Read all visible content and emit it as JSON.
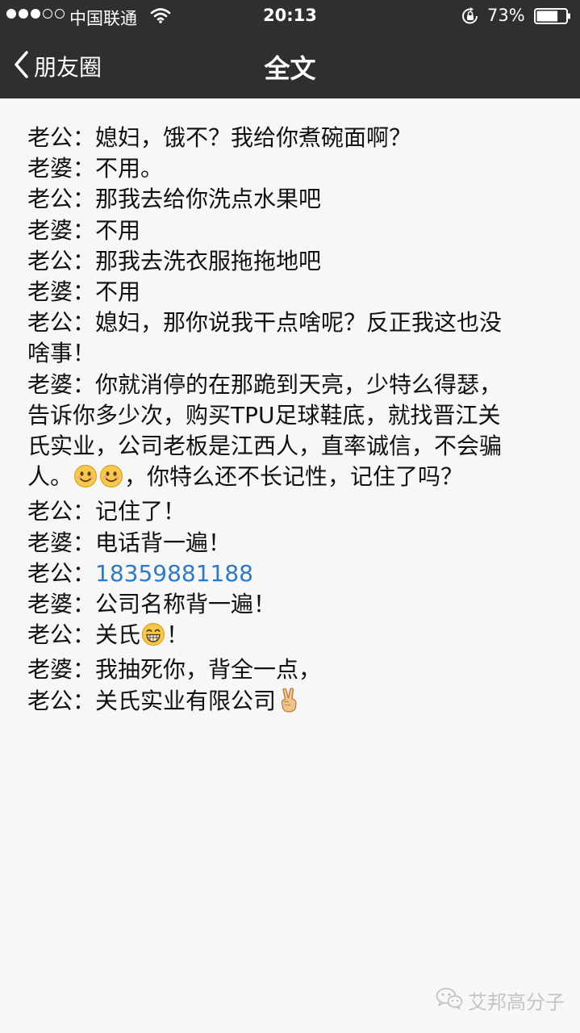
{
  "status_bar": {
    "carrier": "中国联通",
    "time": "20:13",
    "battery": "73%",
    "signal_bars_filled": 3,
    "signal_bars_total": 5,
    "battery_level": 0.73
  },
  "nav": {
    "back_label": "朋友圈",
    "title": "全文"
  },
  "article": {
    "lines": [
      "老公：媳妇，饿不？我给你煮碗面啊？",
      "老婆：不用。",
      "老公：那我去给你洗点水果吧",
      "老婆：不用",
      "老公：那我去洗衣服拖拖地吧",
      "老婆：不用",
      "老公：媳妇，那你说我干点啥呢？反正我这也没",
      "啥事！",
      "老婆：你就消停的在那跪到天亮，少特么得瑟，",
      "告诉你多少次，购买TPU足球鞋底，就找晋江关",
      "氏实业，公司老板是江西人，直率诚信，不会骗",
      "人。",
      "，你特么还不长记性，记住了吗？",
      "老公：记住了！",
      "老婆：电话背一遍！",
      "老公：",
      "18359881188",
      "老婆：公司名称背一遍！",
      "老公：关氏",
      "！",
      "老婆：我抽死你，背全一点，",
      "老公：关氏实业有限公司"
    ]
  },
  "emojis": {
    "smile": "smile-emoji",
    "grin": "grin-emoji",
    "victory": "victory-hand-emoji"
  },
  "watermark": {
    "text": "艾邦高分子"
  },
  "colors": {
    "header_bg": "#2f2f31",
    "page_bg": "#f7f7f7",
    "link": "#2f79c9"
  }
}
